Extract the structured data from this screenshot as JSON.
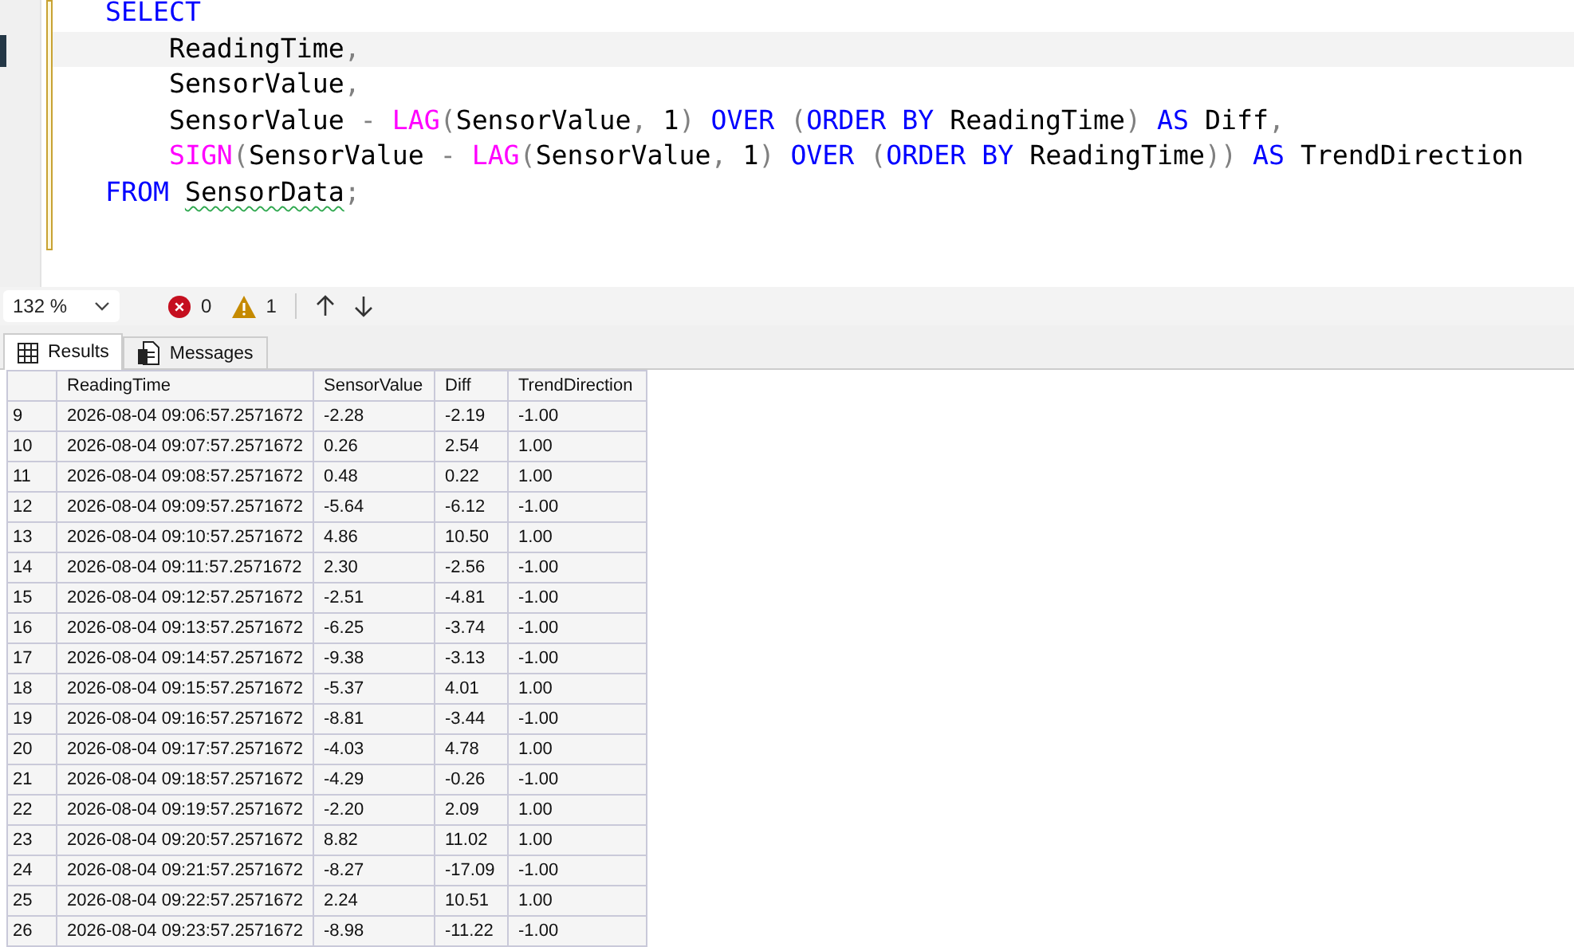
{
  "editor": {
    "lines": [
      {
        "current": false,
        "tokens": [
          {
            "text": "SELECT",
            "kind": "keyword"
          }
        ]
      },
      {
        "current": true,
        "tokens": [
          {
            "text": "    ReadingTime",
            "kind": "name"
          },
          {
            "text": ",",
            "kind": "punct"
          }
        ]
      },
      {
        "current": false,
        "tokens": [
          {
            "text": "    SensorValue",
            "kind": "name"
          },
          {
            "text": ",",
            "kind": "punct"
          }
        ]
      },
      {
        "current": false,
        "tokens": [
          {
            "text": "    SensorValue",
            "kind": "name"
          },
          {
            "text": " - ",
            "kind": "punct"
          },
          {
            "text": "LAG",
            "kind": "function"
          },
          {
            "text": "(",
            "kind": "punct"
          },
          {
            "text": "SensorValue",
            "kind": "name"
          },
          {
            "text": ",",
            "kind": "punct"
          },
          {
            "text": " 1",
            "kind": "name"
          },
          {
            "text": ")",
            "kind": "punct"
          },
          {
            "text": " OVER ",
            "kind": "keyword"
          },
          {
            "text": "(",
            "kind": "punct"
          },
          {
            "text": "ORDER BY",
            "kind": "keyword"
          },
          {
            "text": " ReadingTime",
            "kind": "name"
          },
          {
            "text": ")",
            "kind": "punct"
          },
          {
            "text": " AS",
            "kind": "keyword"
          },
          {
            "text": " Diff",
            "kind": "name"
          },
          {
            "text": ",",
            "kind": "punct"
          }
        ]
      },
      {
        "current": false,
        "tokens": [
          {
            "text": "    SIGN",
            "kind": "function"
          },
          {
            "text": "(",
            "kind": "punct"
          },
          {
            "text": "SensorValue",
            "kind": "name"
          },
          {
            "text": " - ",
            "kind": "punct"
          },
          {
            "text": "LAG",
            "kind": "function"
          },
          {
            "text": "(",
            "kind": "punct"
          },
          {
            "text": "SensorValue",
            "kind": "name"
          },
          {
            "text": ",",
            "kind": "punct"
          },
          {
            "text": " 1",
            "kind": "name"
          },
          {
            "text": ")",
            "kind": "punct"
          },
          {
            "text": " OVER ",
            "kind": "keyword"
          },
          {
            "text": "(",
            "kind": "punct"
          },
          {
            "text": "ORDER BY",
            "kind": "keyword"
          },
          {
            "text": " ReadingTime",
            "kind": "name"
          },
          {
            "text": "))",
            "kind": "punct"
          },
          {
            "text": " AS",
            "kind": "keyword"
          },
          {
            "text": " TrendDirection",
            "kind": "name"
          }
        ]
      },
      {
        "current": false,
        "tokens": [
          {
            "text": "FROM ",
            "kind": "keyword"
          },
          {
            "text": "SensorData",
            "kind": "name",
            "squiggle": true
          },
          {
            "text": ";",
            "kind": "punct"
          }
        ]
      }
    ]
  },
  "toolbar": {
    "zoom": "132 %",
    "errors": "0",
    "warnings": "1"
  },
  "tabs": [
    {
      "label": "Results",
      "selected": true
    },
    {
      "label": "Messages",
      "selected": false
    }
  ],
  "grid": {
    "columns": [
      "ReadingTime",
      "SensorValue",
      "Diff",
      "TrendDirection"
    ],
    "rows": [
      {
        "row_number": "9",
        "cells": [
          "2026-08-04 09:06:57.2571672",
          "-2.28",
          "-2.19",
          "-1.00"
        ]
      },
      {
        "row_number": "10",
        "cells": [
          "2026-08-04 09:07:57.2571672",
          "0.26",
          "2.54",
          "1.00"
        ]
      },
      {
        "row_number": "11",
        "cells": [
          "2026-08-04 09:08:57.2571672",
          "0.48",
          "0.22",
          "1.00"
        ]
      },
      {
        "row_number": "12",
        "cells": [
          "2026-08-04 09:09:57.2571672",
          "-5.64",
          "-6.12",
          "-1.00"
        ]
      },
      {
        "row_number": "13",
        "cells": [
          "2026-08-04 09:10:57.2571672",
          "4.86",
          "10.50",
          "1.00"
        ]
      },
      {
        "row_number": "14",
        "cells": [
          "2026-08-04 09:11:57.2571672",
          "2.30",
          "-2.56",
          "-1.00"
        ]
      },
      {
        "row_number": "15",
        "cells": [
          "2026-08-04 09:12:57.2571672",
          "-2.51",
          "-4.81",
          "-1.00"
        ]
      },
      {
        "row_number": "16",
        "cells": [
          "2026-08-04 09:13:57.2571672",
          "-6.25",
          "-3.74",
          "-1.00"
        ]
      },
      {
        "row_number": "17",
        "cells": [
          "2026-08-04 09:14:57.2571672",
          "-9.38",
          "-3.13",
          "-1.00"
        ]
      },
      {
        "row_number": "18",
        "cells": [
          "2026-08-04 09:15:57.2571672",
          "-5.37",
          "4.01",
          "1.00"
        ]
      },
      {
        "row_number": "19",
        "cells": [
          "2026-08-04 09:16:57.2571672",
          "-8.81",
          "-3.44",
          "-1.00"
        ]
      },
      {
        "row_number": "20",
        "cells": [
          "2026-08-04 09:17:57.2571672",
          "-4.03",
          "4.78",
          "1.00"
        ]
      },
      {
        "row_number": "21",
        "cells": [
          "2026-08-04 09:18:57.2571672",
          "-4.29",
          "-0.26",
          "-1.00"
        ]
      },
      {
        "row_number": "22",
        "cells": [
          "2026-08-04 09:19:57.2571672",
          "-2.20",
          "2.09",
          "1.00"
        ]
      },
      {
        "row_number": "23",
        "cells": [
          "2026-08-04 09:20:57.2571672",
          "8.82",
          "11.02",
          "1.00"
        ]
      },
      {
        "row_number": "24",
        "cells": [
          "2026-08-04 09:21:57.2571672",
          "-8.27",
          "-17.09",
          "-1.00"
        ]
      },
      {
        "row_number": "25",
        "cells": [
          "2026-08-04 09:22:57.2571672",
          "2.24",
          "10.51",
          "1.00"
        ]
      },
      {
        "row_number": "26",
        "cells": [
          "2026-08-04 09:23:57.2571672",
          "-8.98",
          "-11.22",
          "-1.00"
        ]
      }
    ]
  }
}
